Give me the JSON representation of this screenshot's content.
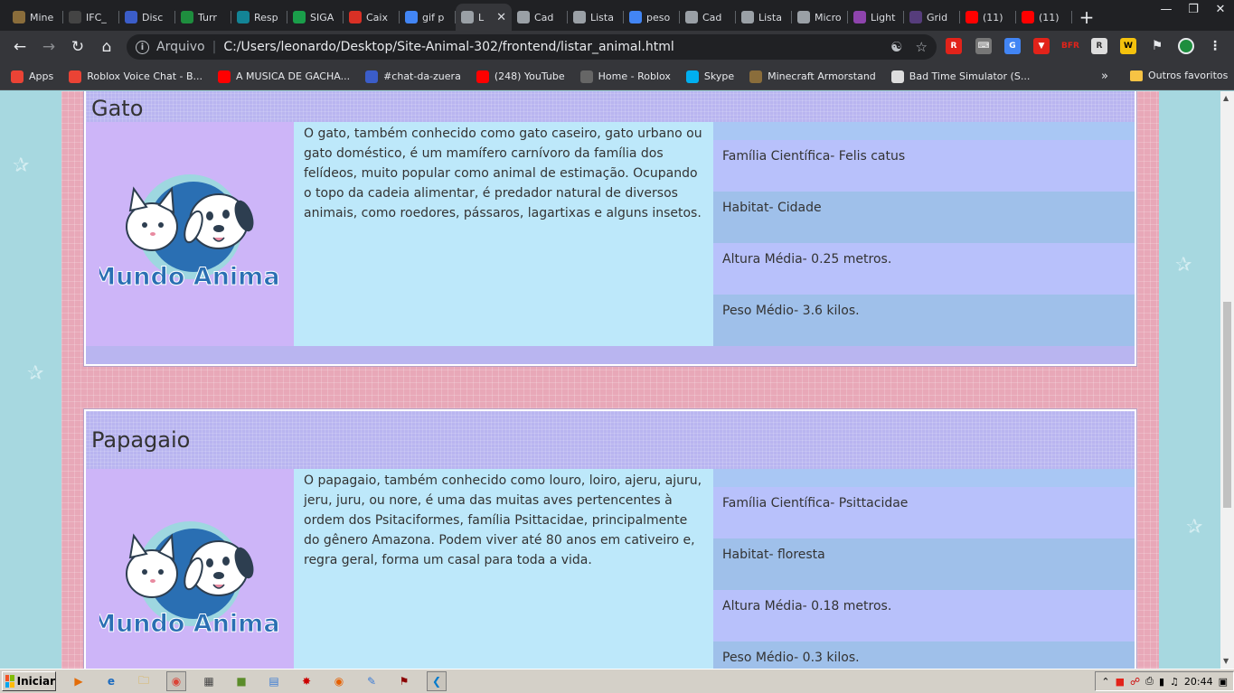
{
  "tabs": [
    {
      "label": "Mine",
      "icon": "minecraft-icon",
      "color": "#8a6d3b"
    },
    {
      "label": "IFC_",
      "icon": "github-icon",
      "color": "#444444"
    },
    {
      "label": "Disc",
      "icon": "6k-icon",
      "color": "#3b5dc9"
    },
    {
      "label": "Turr",
      "icon": "classroom-icon",
      "color": "#1e8e3e"
    },
    {
      "label": "Resp",
      "icon": "classroom-icon",
      "color": "#138496"
    },
    {
      "label": "SIGA",
      "icon": "sheets-icon",
      "color": "#1a9e4a"
    },
    {
      "label": "Caix",
      "icon": "gmail-icon",
      "color": "#d93025"
    },
    {
      "label": "gif p",
      "icon": "google-icon",
      "color": "#4285f4"
    },
    {
      "label": "L",
      "icon": "globe-icon",
      "color": "#9aa0a6",
      "active": true
    },
    {
      "label": "Cad",
      "icon": "globe-icon",
      "color": "#9aa0a6"
    },
    {
      "label": "Lista",
      "icon": "globe-icon",
      "color": "#9aa0a6"
    },
    {
      "label": "peso",
      "icon": "google-icon",
      "color": "#4285f4"
    },
    {
      "label": "Cad",
      "icon": "globe-icon",
      "color": "#9aa0a6"
    },
    {
      "label": "Lista",
      "icon": "globe-icon",
      "color": "#9aa0a6"
    },
    {
      "label": "Micro",
      "icon": "globe-icon",
      "color": "#9aa0a6"
    },
    {
      "label": "Light",
      "icon": "feather-icon",
      "color": "#8e44ad"
    },
    {
      "label": "Grid",
      "icon": "bootstrap-icon",
      "color": "#563d7c"
    },
    {
      "label": "(11)",
      "icon": "youtube-icon",
      "color": "#ff0000"
    },
    {
      "label": "(11)",
      "icon": "youtube-icon",
      "color": "#ff0000"
    }
  ],
  "toolbar": {
    "scheme": "Arquivo",
    "url": "C:/Users/leonardo/Desktop/Site-Animal-302/frontend/listar_animal.html"
  },
  "bookmarks": [
    {
      "label": "Apps",
      "icon": "apps-icon",
      "color": "#ea4335"
    },
    {
      "label": "Roblox Voice Chat - B...",
      "icon": "chrome-icon",
      "color": "#ea4335"
    },
    {
      "label": "A MUSICA DE GACHA...",
      "icon": "youtube-icon",
      "color": "#ff0000"
    },
    {
      "label": "#chat-da-zuera",
      "icon": "6k-icon",
      "color": "#3b5dc9"
    },
    {
      "label": "(248) YouTube",
      "icon": "youtube-icon",
      "color": "#ff0000"
    },
    {
      "label": "Home - Roblox",
      "icon": "roblox-icon",
      "color": "#666666"
    },
    {
      "label": "Skype",
      "icon": "skype-icon",
      "color": "#00aff0"
    },
    {
      "label": "Minecraft Armorstand",
      "icon": "armorstand-icon",
      "color": "#8a6d3b"
    },
    {
      "label": "Bad Time Simulator (S...",
      "icon": "skull-icon",
      "color": "#dddddd"
    }
  ],
  "bookmarks_other": "Outros favoritos",
  "animals": [
    {
      "name": "Gato",
      "description": "O gato, também conhecido como gato caseiro, gato urbano ou gato doméstico, é um mamífero carnívoro da família dos felídeos, muito popular como animal de estimação. Ocupando o topo da cadeia alimentar, é predador natural de diversos animais, como roedores, pássaros, lagartixas e alguns insetos.",
      "logo_text": "Mundo Animal",
      "facts": [
        "Família Científica- Felis catus",
        "Habitat- Cidade",
        "Altura Média- 0.25 metros.",
        "Peso Médio- 3.6 kilos."
      ]
    },
    {
      "name": "Papagaio",
      "description": "O papagaio, também conhecido como louro, loiro, ajeru, ajuru, jeru, juru, ou nore, é uma das muitas aves pertencentes à ordem dos Psitaciformes, família Psittacidae, principalmente do gênero Amazona. Podem viver até 80 anos em cativeiro e, regra geral, forma um casal para toda a vida.",
      "logo_text": "Mundo Animal",
      "facts": [
        "Família Científica- Psittacidae",
        "Habitat- floresta",
        "Altura Média- 0.18 metros.",
        "Peso Médio- 0.3 kilos."
      ]
    }
  ],
  "taskbar": {
    "start_label": "Iniciar",
    "clock": "20:44"
  }
}
